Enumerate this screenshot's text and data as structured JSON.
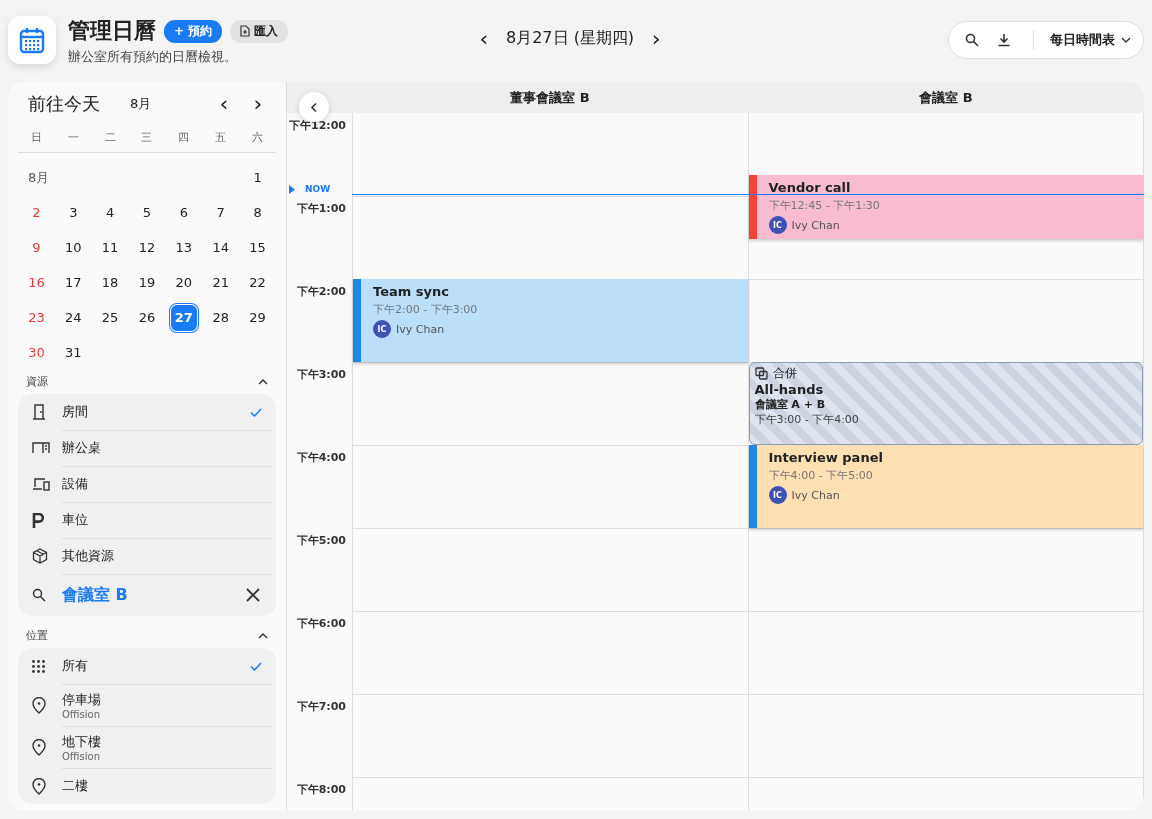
{
  "header": {
    "title": "管理日曆",
    "book_button": "+ 預約",
    "import_button": "匯入",
    "subtitle": "辦公室所有預約的日曆檢視。"
  },
  "date_nav": {
    "prev": "‹",
    "label": "8月27日 (星期四)",
    "next": "›"
  },
  "toolbar": {
    "view": "每日時間表"
  },
  "mini_calendar": {
    "today_button": "前往今天",
    "month": "8月",
    "prev": "‹",
    "next": "›",
    "weekdays": [
      "日",
      "一",
      "二",
      "三",
      "四",
      "五",
      "六"
    ],
    "month_label": "8月",
    "days": [
      {
        "label": "1",
        "selected": false
      },
      {
        "label": "2",
        "selected": false
      },
      {
        "label": "3",
        "selected": false
      },
      {
        "label": "4",
        "selected": false
      },
      {
        "label": "5",
        "selected": false
      },
      {
        "label": "6",
        "selected": false
      },
      {
        "label": "7",
        "selected": false
      },
      {
        "label": "8",
        "selected": false
      },
      {
        "label": "9",
        "selected": false
      },
      {
        "label": "10",
        "selected": false
      },
      {
        "label": "11",
        "selected": false
      },
      {
        "label": "12",
        "selected": false
      },
      {
        "label": "13",
        "selected": false
      },
      {
        "label": "14",
        "selected": false
      },
      {
        "label": "15",
        "selected": false
      },
      {
        "label": "16",
        "selected": false
      },
      {
        "label": "17",
        "selected": false
      },
      {
        "label": "18",
        "selected": false
      },
      {
        "label": "19",
        "selected": false
      },
      {
        "label": "20",
        "selected": false
      },
      {
        "label": "21",
        "selected": false
      },
      {
        "label": "22",
        "selected": false
      },
      {
        "label": "23",
        "selected": false
      },
      {
        "label": "24",
        "selected": false
      },
      {
        "label": "25",
        "selected": false
      },
      {
        "label": "26",
        "selected": false
      },
      {
        "label": "27",
        "selected": true
      },
      {
        "label": "28",
        "selected": false
      },
      {
        "label": "29",
        "selected": false
      },
      {
        "label": "30",
        "selected": false
      },
      {
        "label": "31",
        "selected": false
      }
    ]
  },
  "resources": {
    "title": "資源",
    "expanded": true,
    "items": [
      {
        "kind": "room",
        "label": "房間",
        "checked": true
      },
      {
        "kind": "desk",
        "label": "辦公桌",
        "checked": false
      },
      {
        "kind": "equipment",
        "label": "設備",
        "checked": false
      },
      {
        "kind": "parking",
        "label": "車位",
        "checked": false
      },
      {
        "kind": "other",
        "label": "其他資源",
        "checked": false
      }
    ],
    "search_value": "會議室 B"
  },
  "locations": {
    "title": "位置",
    "expanded": true,
    "items": [
      {
        "kind": "all",
        "label": "所有",
        "checked": true
      },
      {
        "kind": "place",
        "label": "停車場",
        "sub": "Offision",
        "checked": false
      },
      {
        "kind": "place",
        "label": "地下樓",
        "sub": "Offision",
        "checked": false
      },
      {
        "kind": "place",
        "label": "二樓",
        "checked": false
      }
    ]
  },
  "schedule": {
    "columns": [
      {
        "name": "董事會議室 B",
        "events": [
          {
            "kind": "booking",
            "title": "Team sync",
            "time": "下午2:00 - 下午3:00",
            "initials": "IC",
            "person": "Ivy Chan",
            "color": "#bbdefb",
            "accent": {
              "color": "#1e88e5"
            }
          }
        ]
      },
      {
        "name": "會議室 B",
        "events": [
          {
            "kind": "booking",
            "title": "Vendor call",
            "time": "下午12:45 - 下午1:30",
            "initials": "IC",
            "person": "Ivy Chan",
            "color": "#f8bbd0",
            "accent": {
              "color": "#f44336"
            }
          },
          {
            "kind": "merged",
            "tag": "合併",
            "title": "All-hands",
            "rooms": "會議室 A + B",
            "time": "下午3:00 - 下午4:00"
          },
          {
            "kind": "booking",
            "title": "Interview panel",
            "time": "下午4:00 - 下午5:00",
            "initials": "IC",
            "person": "Ivy Chan",
            "color": "#ffe0b2",
            "accent": {
              "color": "#1e88e5"
            }
          }
        ]
      }
    ],
    "hours": [
      "下午12:00",
      "下午1:00",
      "下午2:00",
      "下午3:00",
      "下午4:00",
      "下午5:00",
      "下午6:00",
      "下午7:00",
      "下午8:00"
    ],
    "now_label": "NOW"
  }
}
